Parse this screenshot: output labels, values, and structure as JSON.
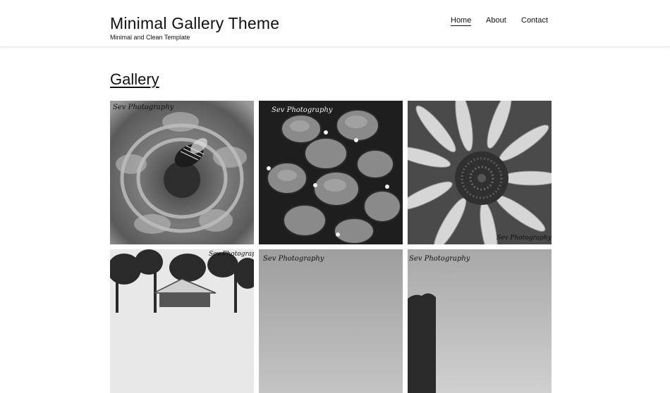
{
  "site": {
    "title": "Minimal Gallery Theme",
    "tagline": "Minimal and Clean Template"
  },
  "nav": {
    "items": [
      {
        "label": "Home",
        "active": true
      },
      {
        "label": "About",
        "active": false
      },
      {
        "label": "Contact",
        "active": false
      }
    ]
  },
  "gallery": {
    "heading": "Gallery",
    "items": [
      {
        "subject": "bee on flower",
        "watermark": "Sev Photography"
      },
      {
        "subject": "hydrangea petals",
        "watermark": "Sev Photography"
      },
      {
        "subject": "sunflower",
        "watermark": "Sev Photography"
      },
      {
        "subject": "pavilion among trees",
        "watermark": "Sev Photography"
      },
      {
        "subject": "grey sky",
        "watermark": "Sev Photography"
      },
      {
        "subject": "grey sky with treeline",
        "watermark": "Sev Photography"
      }
    ]
  },
  "colors": {
    "text": "#111111",
    "header_border": "#e6e6e6",
    "background": "#ffffff"
  }
}
